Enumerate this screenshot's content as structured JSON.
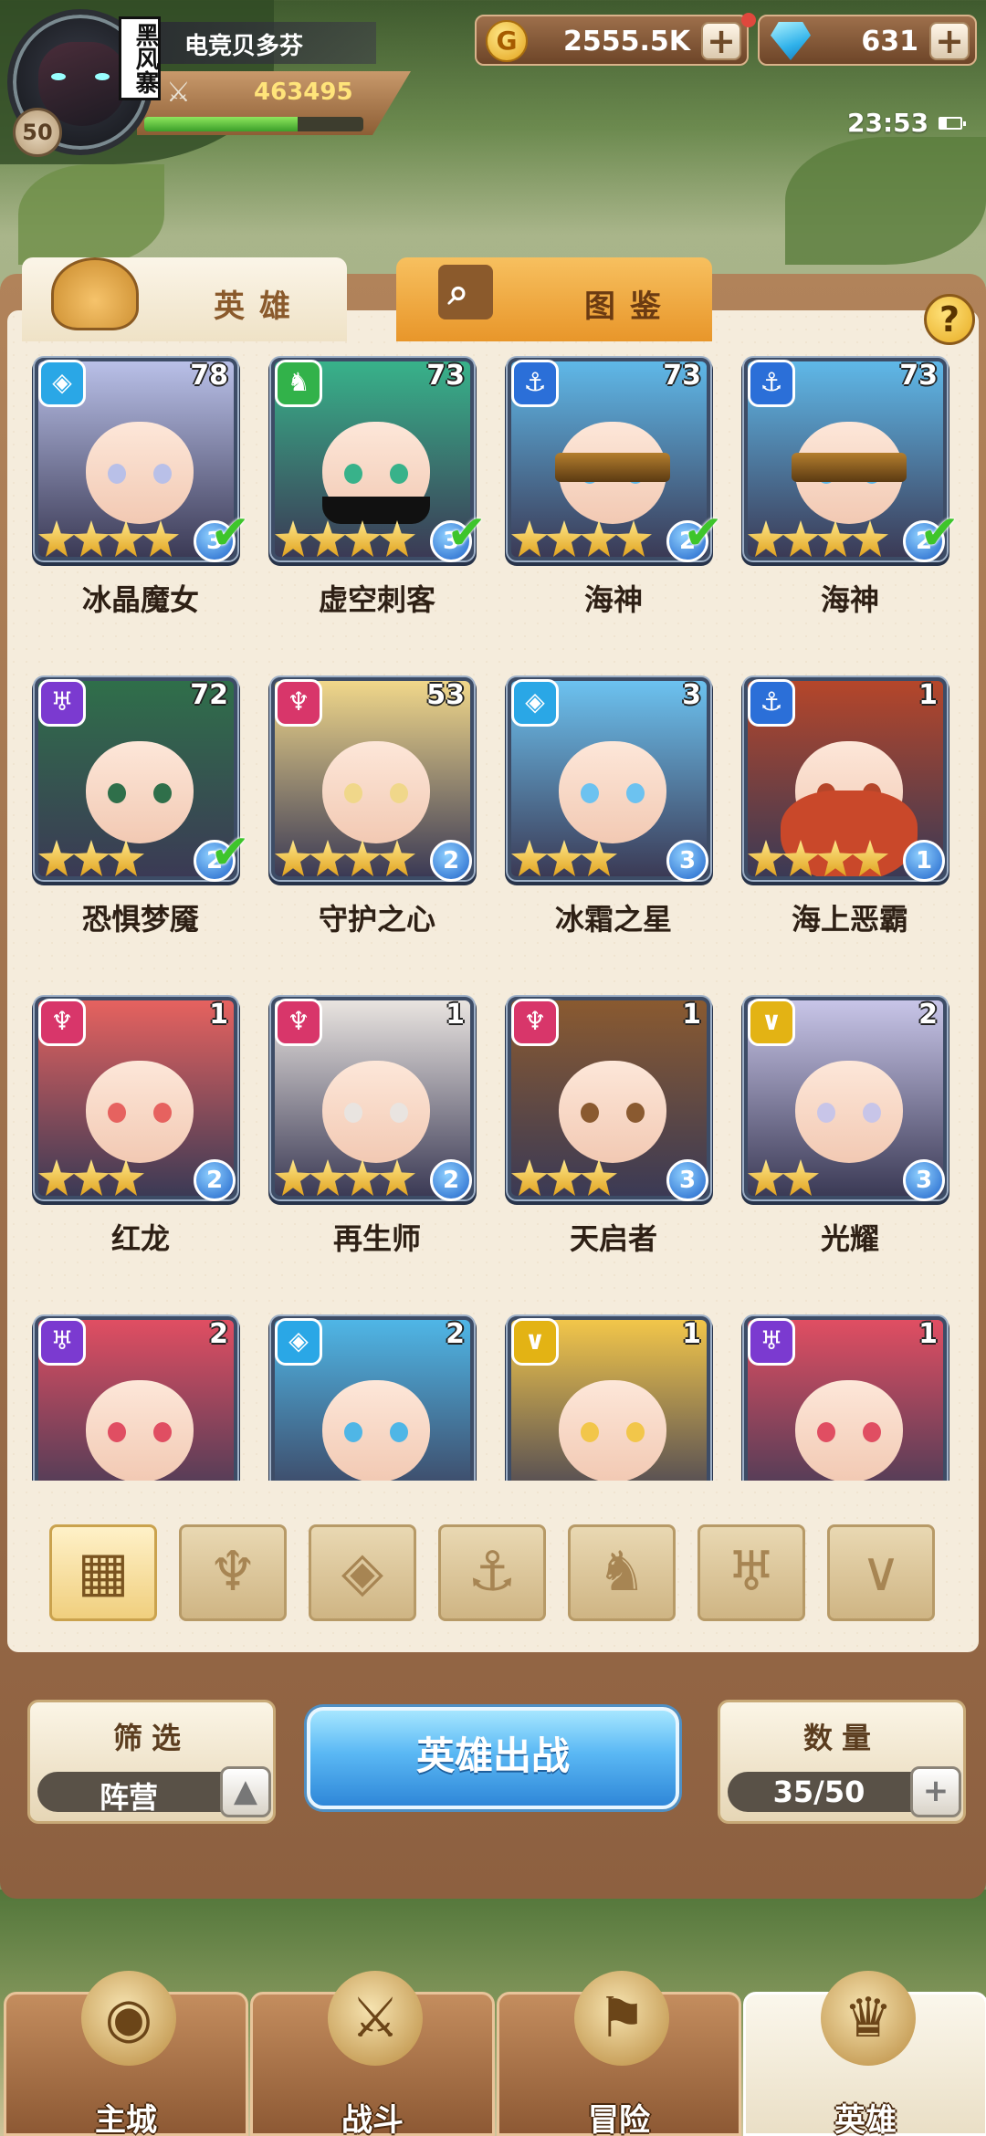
{
  "player": {
    "name": "电竞贝多芬",
    "avatar_tag": "黑风寨",
    "level": "50",
    "power": "463495",
    "exp_fraction": 0.7
  },
  "resources": {
    "gold": "2555.5K",
    "gems": "631",
    "plus": "+"
  },
  "status": {
    "time": "23:53"
  },
  "tabs": {
    "heroes": "英雄",
    "codex": "图鉴",
    "help": "?"
  },
  "heroes": [
    {
      "name": "冰晶魔女",
      "level": "78",
      "grade": "3",
      "stars": 4,
      "deployed": true,
      "faction": "water",
      "color": "#b9c0e8"
    },
    {
      "name": "虚空刺客",
      "level": "73",
      "grade": "3",
      "stars": 4,
      "deployed": true,
      "faction": "beast",
      "color": "#38b28a"
    },
    {
      "name": "海神",
      "level": "73",
      "grade": "2",
      "stars": 4,
      "deployed": true,
      "faction": "anchor",
      "color": "#5fb8e8"
    },
    {
      "name": "海神",
      "level": "73",
      "grade": "2",
      "stars": 4,
      "deployed": true,
      "faction": "anchor",
      "color": "#5fb8e8"
    },
    {
      "name": "恐惧梦魇",
      "level": "72",
      "grade": "2",
      "stars": 3,
      "deployed": true,
      "faction": "demon",
      "color": "#2f6f4a"
    },
    {
      "name": "守护之心",
      "level": "53",
      "grade": "2",
      "stars": 4,
      "deployed": false,
      "faction": "fire",
      "color": "#f0d78a"
    },
    {
      "name": "冰霜之星",
      "level": "3",
      "grade": "3",
      "stars": 3,
      "deployed": false,
      "faction": "water",
      "color": "#6cc2f0"
    },
    {
      "name": "海上恶霸",
      "level": "1",
      "grade": "1",
      "stars": 4,
      "deployed": false,
      "faction": "anchor",
      "color": "#b5462a"
    },
    {
      "name": "红龙",
      "level": "1",
      "grade": "2",
      "stars": 3,
      "deployed": false,
      "faction": "fire",
      "color": "#e6625f"
    },
    {
      "name": "再生师",
      "level": "1",
      "grade": "2",
      "stars": 4,
      "deployed": false,
      "faction": "fire",
      "color": "#e9e4e0"
    },
    {
      "name": "天启者",
      "level": "1",
      "grade": "3",
      "stars": 3,
      "deployed": false,
      "faction": "fire",
      "color": "#8a5a30"
    },
    {
      "name": "光耀",
      "level": "2",
      "grade": "3",
      "stars": 2,
      "deployed": false,
      "faction": "light",
      "color": "#c8c5e8"
    },
    {
      "name": "",
      "level": "2",
      "grade": "",
      "stars": 0,
      "deployed": false,
      "faction": "demon",
      "color": "#e04e62"
    },
    {
      "name": "",
      "level": "2",
      "grade": "",
      "stars": 0,
      "deployed": false,
      "faction": "water",
      "color": "#4fb6e6"
    },
    {
      "name": "",
      "level": "1",
      "grade": "",
      "stars": 0,
      "deployed": false,
      "faction": "light",
      "color": "#f2c64a"
    },
    {
      "name": "",
      "level": "1",
      "grade": "",
      "stars": 0,
      "deployed": false,
      "faction": "demon",
      "color": "#e04e62"
    }
  ],
  "faction_colors": {
    "water": "#2aa7e6",
    "beast": "#32b24a",
    "anchor": "#2b6fd8",
    "demon": "#7b3ad0",
    "fire": "#d8366a",
    "light": "#e3b314"
  },
  "filter_tabs": [
    {
      "icon": "all-grid-icon",
      "glyph": "▦",
      "active": true
    },
    {
      "icon": "fire-faction-icon",
      "glyph": "♆",
      "active": false
    },
    {
      "icon": "water-faction-icon",
      "glyph": "◈",
      "active": false
    },
    {
      "icon": "anchor-faction-icon",
      "glyph": "⚓",
      "active": false
    },
    {
      "icon": "beast-faction-icon",
      "glyph": "♞",
      "active": false
    },
    {
      "icon": "demon-faction-icon",
      "glyph": "♅",
      "active": false
    },
    {
      "icon": "light-faction-icon",
      "glyph": "∨",
      "active": false
    }
  ],
  "controls": {
    "filter_title": "筛选",
    "filter_value": "阵营",
    "deploy": "英雄出战",
    "count_title": "数量",
    "count_value": "35/50"
  },
  "nav": [
    {
      "label": "主城",
      "icon": "main-city-icon",
      "active": false
    },
    {
      "label": "战斗",
      "icon": "battle-icon",
      "active": false
    },
    {
      "label": "冒险",
      "icon": "adventure-icon",
      "active": false
    },
    {
      "label": "英雄",
      "icon": "hero-icon",
      "active": true
    }
  ]
}
